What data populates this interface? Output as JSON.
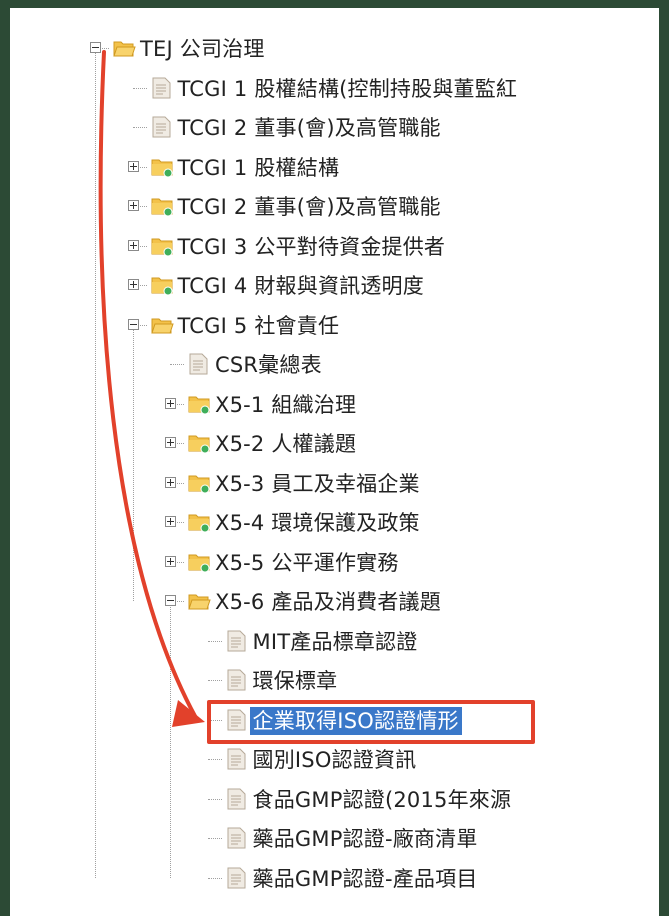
{
  "tree": {
    "rows": [
      {
        "label": "TEJ 公司治理",
        "level": 0,
        "icon": "folder-open-icon",
        "expander": "minus"
      },
      {
        "label": "TCGI 1 股權結構(控制持股與董監紅",
        "level": 1,
        "icon": "document-icon",
        "expander": "none"
      },
      {
        "label": "TCGI 2 董事(會)及高管職能",
        "level": 1,
        "icon": "document-icon",
        "expander": "none"
      },
      {
        "label": "TCGI 1 股權結構",
        "level": 1,
        "icon": "folder-badge-icon",
        "expander": "plus"
      },
      {
        "label": "TCGI 2 董事(會)及高管職能",
        "level": 1,
        "icon": "folder-badge-icon",
        "expander": "plus"
      },
      {
        "label": "TCGI 3 公平對待資金提供者",
        "level": 1,
        "icon": "folder-badge-icon",
        "expander": "plus"
      },
      {
        "label": "TCGI 4 財報與資訊透明度",
        "level": 1,
        "icon": "folder-badge-icon",
        "expander": "plus"
      },
      {
        "label": "TCGI 5 社會責任",
        "level": 1,
        "icon": "folder-open-icon",
        "expander": "minus"
      },
      {
        "label": "CSR彙總表",
        "level": 2,
        "icon": "document-icon",
        "expander": "none"
      },
      {
        "label": "X5-1 組織治理",
        "level": 2,
        "icon": "folder-badge-icon",
        "expander": "plus"
      },
      {
        "label": "X5-2 人權議題",
        "level": 2,
        "icon": "folder-badge-icon",
        "expander": "plus"
      },
      {
        "label": "X5-3 員工及幸福企業",
        "level": 2,
        "icon": "folder-badge-icon",
        "expander": "plus"
      },
      {
        "label": "X5-4 環境保護及政策",
        "level": 2,
        "icon": "folder-badge-icon",
        "expander": "plus"
      },
      {
        "label": "X5-5 公平運作實務",
        "level": 2,
        "icon": "folder-badge-icon",
        "expander": "plus"
      },
      {
        "label": "X5-6 產品及消費者議題",
        "level": 2,
        "icon": "folder-open-icon",
        "expander": "minus"
      },
      {
        "label": "MIT產品標章認證",
        "level": 3,
        "icon": "document-icon",
        "expander": "none"
      },
      {
        "label": "環保標章",
        "level": 3,
        "icon": "document-icon",
        "expander": "none"
      },
      {
        "label": "企業取得ISO認證情形",
        "level": 3,
        "icon": "document-icon",
        "expander": "none",
        "selected": true
      },
      {
        "label": "國別ISO認證資訊",
        "level": 3,
        "icon": "document-icon",
        "expander": "none"
      },
      {
        "label": "食品GMP認證(2015年來源",
        "level": 3,
        "icon": "document-icon",
        "expander": "none"
      },
      {
        "label": "藥品GMP認證-廠商清單",
        "level": 3,
        "icon": "document-icon",
        "expander": "none"
      },
      {
        "label": "藥品GMP認證-產品項目",
        "level": 3,
        "icon": "document-icon",
        "expander": "none"
      }
    ]
  },
  "annotation": {
    "arrow_color": "#e2412b",
    "highlight_color": "#e2412b",
    "selection_color": "#3a78c9",
    "icon": "red-curved-arrow-icon"
  }
}
